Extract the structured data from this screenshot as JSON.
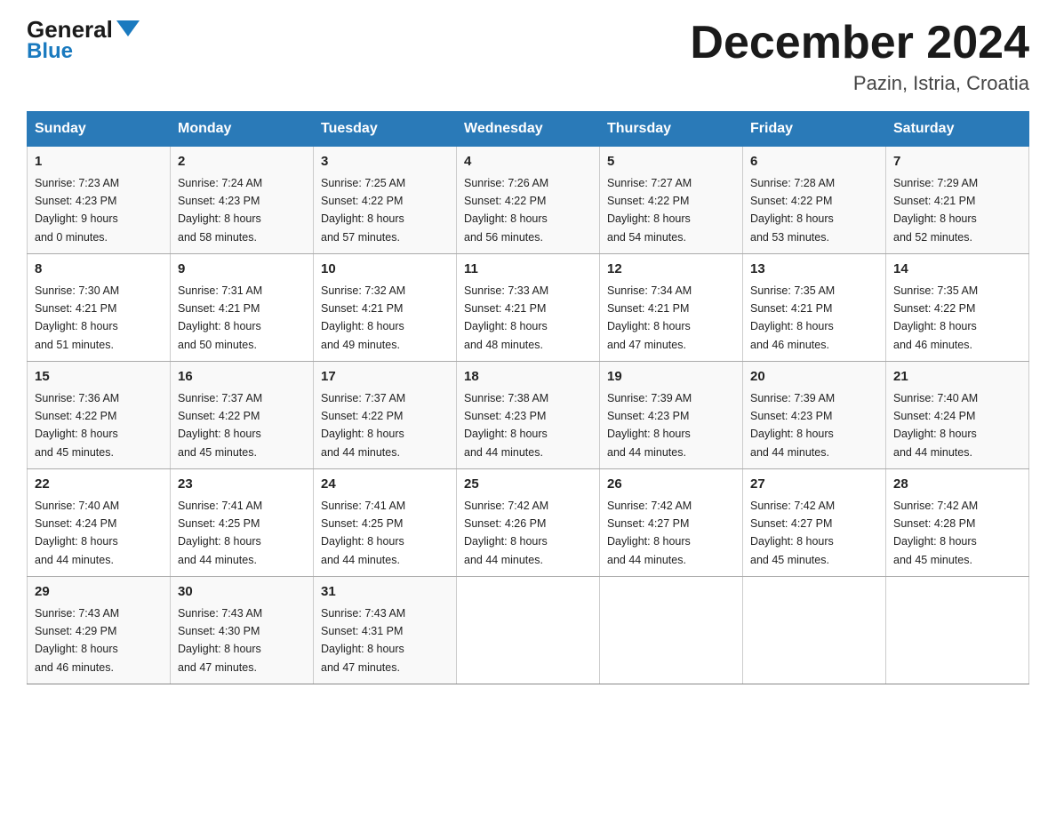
{
  "header": {
    "logo_general": "General",
    "logo_blue": "Blue",
    "month_title": "December 2024",
    "location": "Pazin, Istria, Croatia"
  },
  "weekdays": [
    "Sunday",
    "Monday",
    "Tuesday",
    "Wednesday",
    "Thursday",
    "Friday",
    "Saturday"
  ],
  "weeks": [
    [
      {
        "day": "1",
        "sunrise": "7:23 AM",
        "sunset": "4:23 PM",
        "daylight_hours": "9",
        "daylight_minutes": "0"
      },
      {
        "day": "2",
        "sunrise": "7:24 AM",
        "sunset": "4:23 PM",
        "daylight_hours": "8",
        "daylight_minutes": "58"
      },
      {
        "day": "3",
        "sunrise": "7:25 AM",
        "sunset": "4:22 PM",
        "daylight_hours": "8",
        "daylight_minutes": "57"
      },
      {
        "day": "4",
        "sunrise": "7:26 AM",
        "sunset": "4:22 PM",
        "daylight_hours": "8",
        "daylight_minutes": "56"
      },
      {
        "day": "5",
        "sunrise": "7:27 AM",
        "sunset": "4:22 PM",
        "daylight_hours": "8",
        "daylight_minutes": "54"
      },
      {
        "day": "6",
        "sunrise": "7:28 AM",
        "sunset": "4:22 PM",
        "daylight_hours": "8",
        "daylight_minutes": "53"
      },
      {
        "day": "7",
        "sunrise": "7:29 AM",
        "sunset": "4:21 PM",
        "daylight_hours": "8",
        "daylight_minutes": "52"
      }
    ],
    [
      {
        "day": "8",
        "sunrise": "7:30 AM",
        "sunset": "4:21 PM",
        "daylight_hours": "8",
        "daylight_minutes": "51"
      },
      {
        "day": "9",
        "sunrise": "7:31 AM",
        "sunset": "4:21 PM",
        "daylight_hours": "8",
        "daylight_minutes": "50"
      },
      {
        "day": "10",
        "sunrise": "7:32 AM",
        "sunset": "4:21 PM",
        "daylight_hours": "8",
        "daylight_minutes": "49"
      },
      {
        "day": "11",
        "sunrise": "7:33 AM",
        "sunset": "4:21 PM",
        "daylight_hours": "8",
        "daylight_minutes": "48"
      },
      {
        "day": "12",
        "sunrise": "7:34 AM",
        "sunset": "4:21 PM",
        "daylight_hours": "8",
        "daylight_minutes": "47"
      },
      {
        "day": "13",
        "sunrise": "7:35 AM",
        "sunset": "4:21 PM",
        "daylight_hours": "8",
        "daylight_minutes": "46"
      },
      {
        "day": "14",
        "sunrise": "7:35 AM",
        "sunset": "4:22 PM",
        "daylight_hours": "8",
        "daylight_minutes": "46"
      }
    ],
    [
      {
        "day": "15",
        "sunrise": "7:36 AM",
        "sunset": "4:22 PM",
        "daylight_hours": "8",
        "daylight_minutes": "45"
      },
      {
        "day": "16",
        "sunrise": "7:37 AM",
        "sunset": "4:22 PM",
        "daylight_hours": "8",
        "daylight_minutes": "45"
      },
      {
        "day": "17",
        "sunrise": "7:37 AM",
        "sunset": "4:22 PM",
        "daylight_hours": "8",
        "daylight_minutes": "44"
      },
      {
        "day": "18",
        "sunrise": "7:38 AM",
        "sunset": "4:23 PM",
        "daylight_hours": "8",
        "daylight_minutes": "44"
      },
      {
        "day": "19",
        "sunrise": "7:39 AM",
        "sunset": "4:23 PM",
        "daylight_hours": "8",
        "daylight_minutes": "44"
      },
      {
        "day": "20",
        "sunrise": "7:39 AM",
        "sunset": "4:23 PM",
        "daylight_hours": "8",
        "daylight_minutes": "44"
      },
      {
        "day": "21",
        "sunrise": "7:40 AM",
        "sunset": "4:24 PM",
        "daylight_hours": "8",
        "daylight_minutes": "44"
      }
    ],
    [
      {
        "day": "22",
        "sunrise": "7:40 AM",
        "sunset": "4:24 PM",
        "daylight_hours": "8",
        "daylight_minutes": "44"
      },
      {
        "day": "23",
        "sunrise": "7:41 AM",
        "sunset": "4:25 PM",
        "daylight_hours": "8",
        "daylight_minutes": "44"
      },
      {
        "day": "24",
        "sunrise": "7:41 AM",
        "sunset": "4:25 PM",
        "daylight_hours": "8",
        "daylight_minutes": "44"
      },
      {
        "day": "25",
        "sunrise": "7:42 AM",
        "sunset": "4:26 PM",
        "daylight_hours": "8",
        "daylight_minutes": "44"
      },
      {
        "day": "26",
        "sunrise": "7:42 AM",
        "sunset": "4:27 PM",
        "daylight_hours": "8",
        "daylight_minutes": "44"
      },
      {
        "day": "27",
        "sunrise": "7:42 AM",
        "sunset": "4:27 PM",
        "daylight_hours": "8",
        "daylight_minutes": "45"
      },
      {
        "day": "28",
        "sunrise": "7:42 AM",
        "sunset": "4:28 PM",
        "daylight_hours": "8",
        "daylight_minutes": "45"
      }
    ],
    [
      {
        "day": "29",
        "sunrise": "7:43 AM",
        "sunset": "4:29 PM",
        "daylight_hours": "8",
        "daylight_minutes": "46"
      },
      {
        "day": "30",
        "sunrise": "7:43 AM",
        "sunset": "4:30 PM",
        "daylight_hours": "8",
        "daylight_minutes": "47"
      },
      {
        "day": "31",
        "sunrise": "7:43 AM",
        "sunset": "4:31 PM",
        "daylight_hours": "8",
        "daylight_minutes": "47"
      },
      null,
      null,
      null,
      null
    ]
  ],
  "labels": {
    "sunrise": "Sunrise:",
    "sunset": "Sunset:",
    "daylight": "Daylight:",
    "hours": "hours",
    "and": "and",
    "minutes": "minutes."
  }
}
